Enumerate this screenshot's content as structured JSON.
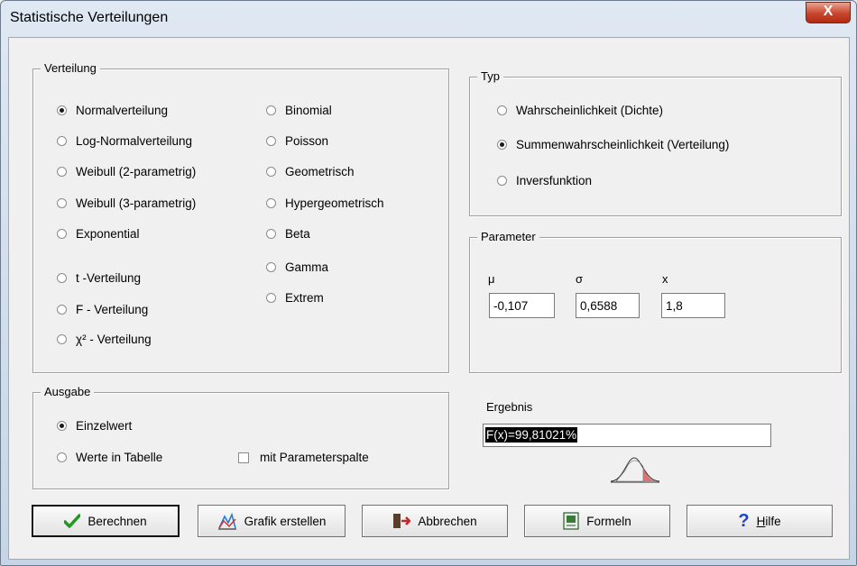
{
  "window": {
    "title": "Statistische Verteilungen",
    "close_label": "X"
  },
  "verteilung": {
    "legend": "Verteilung",
    "col1": [
      "Normalverteilung",
      "Log-Normalverteilung",
      "Weibull (2-parametrig)",
      "Weibull (3-parametrig)",
      "Exponential",
      "t -Verteilung",
      "F - Verteilung",
      "χ² - Verteilung"
    ],
    "col2": [
      "Binomial",
      "Poisson",
      "Geometrisch",
      "Hypergeometrisch",
      "Beta",
      "Gamma",
      "Extrem"
    ],
    "selected": "Normalverteilung"
  },
  "typ": {
    "legend": "Typ",
    "options": [
      "Wahrscheinlichkeit (Dichte)",
      "Summenwahrscheinlichkeit (Verteilung)",
      "Inversfunktion"
    ],
    "selected": "Summenwahrscheinlichkeit (Verteilung)"
  },
  "parameter": {
    "legend": "Parameter",
    "mu_label": "μ",
    "mu_value": "-0,107",
    "sigma_label": "σ",
    "sigma_value": "0,6588",
    "x_label": "x",
    "x_value": "1,8"
  },
  "ausgabe": {
    "legend": "Ausgabe",
    "einzelwert": "Einzelwert",
    "tabelle": "Werte in Tabelle",
    "parameterspalte": "mit Parameterspalte",
    "selected": "Einzelwert"
  },
  "ergebnis": {
    "label": "Ergebnis",
    "value": "F(x)=99,81021%"
  },
  "buttons": {
    "berechnen": "Berechnen",
    "grafik": "Grafik erstellen",
    "abbrechen": "Abbrechen",
    "formeln": "Formeln",
    "hilfe_underlined": "H",
    "hilfe_rest": "ilfe"
  },
  "icons": {
    "berechnen": "checkmark-icon",
    "grafik": "chart-icon",
    "abbrechen": "exit-door-icon",
    "formeln": "formula-book-icon",
    "hilfe": "question-mark-icon"
  },
  "colors": {
    "check_green": "#1f9a1f",
    "help_blue": "#1b3fd0",
    "close_red": "#c8452c"
  }
}
